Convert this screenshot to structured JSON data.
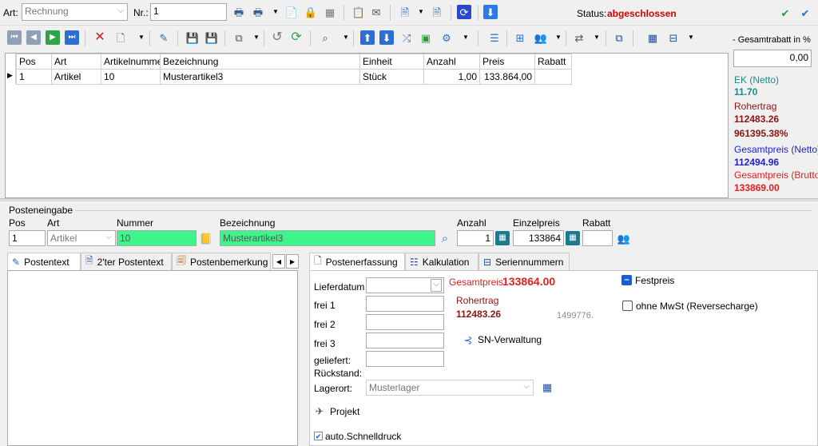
{
  "header": {
    "art_label": "Art:",
    "art_value": "Rechnung",
    "nr_label": "Nr.:",
    "nr_value": "1",
    "status_label": "Status:",
    "status_value": "abgeschlossen",
    "status_color": "#d40000"
  },
  "table": {
    "columns": [
      "Pos",
      "Art",
      "Artikelnummer",
      "Bezeichnung",
      "Einheit",
      "Anzahl",
      "Preis",
      "Rabatt"
    ],
    "rows": [
      [
        "1",
        "Artikel",
        "10",
        "Musterartikel3",
        "Stück",
        "1,00",
        "133.864,00",
        ""
      ]
    ]
  },
  "summary": {
    "gesamtrabatt_label": "- Gesamtrabatt in %",
    "gesamtrabatt_value": "0,00",
    "ek_label": "EK (Netto)",
    "ek_value": "11.70",
    "rohertrag_label": "Rohertrag",
    "rohertrag_value": "112483.26",
    "rohertrag_percent": "961395.38%",
    "netto_label": "Gesamtpreis (Netto)",
    "netto_value": "112494.96",
    "brutto_label": "Gesamtpreis (Brutto)",
    "brutto_value": "133869.00"
  },
  "posteneingabe": {
    "section_label": "Posteneingabe",
    "pos_label": "Pos",
    "pos_value": "1",
    "art_label": "Art",
    "art_value": "Artikel",
    "nummer_label": "Nummer",
    "nummer_value": "10",
    "bezeichnung_label": "Bezeichnung",
    "bezeichnung_value": "Musterartikel3",
    "anzahl_label": "Anzahl",
    "anzahl_value": "1",
    "einzelpreis_label": "Einzelpreis",
    "einzelpreis_value": "133864",
    "rabatt_label": "Rabatt",
    "rabatt_value": ""
  },
  "left_tabs": [
    "Postentext",
    "2'ter Postentext",
    "Postenbemerkung"
  ],
  "right_tabs": [
    "Postenerfassung",
    "Kalkulation",
    "Seriennummern"
  ],
  "erfassung": {
    "lieferdatum_label": "Lieferdatum",
    "frei1_label": "frei 1",
    "frei2_label": "frei 2",
    "frei3_label": "frei 3",
    "geliefert_label": "geliefert:",
    "rueckstand_label": "Rückstand:",
    "lagerort_label": "Lagerort:",
    "lagerort_value": "Musterlager",
    "gesamtpreis_label": "Gesamtpreis",
    "gesamtpreis_value": "133864.00",
    "rohertrag_label": "Rohertrag",
    "rohertrag_value": "112483.26",
    "rohertrag_extra": "1499776.",
    "sn_verwaltung_label": "SN-Verwaltung",
    "festpreis_label": "Festpreis",
    "ohne_mwst_label": "ohne MwSt (Reversecharge)",
    "projekt_label": "Projekt",
    "schnelldruck_label": "auto.Schnelldruck"
  }
}
